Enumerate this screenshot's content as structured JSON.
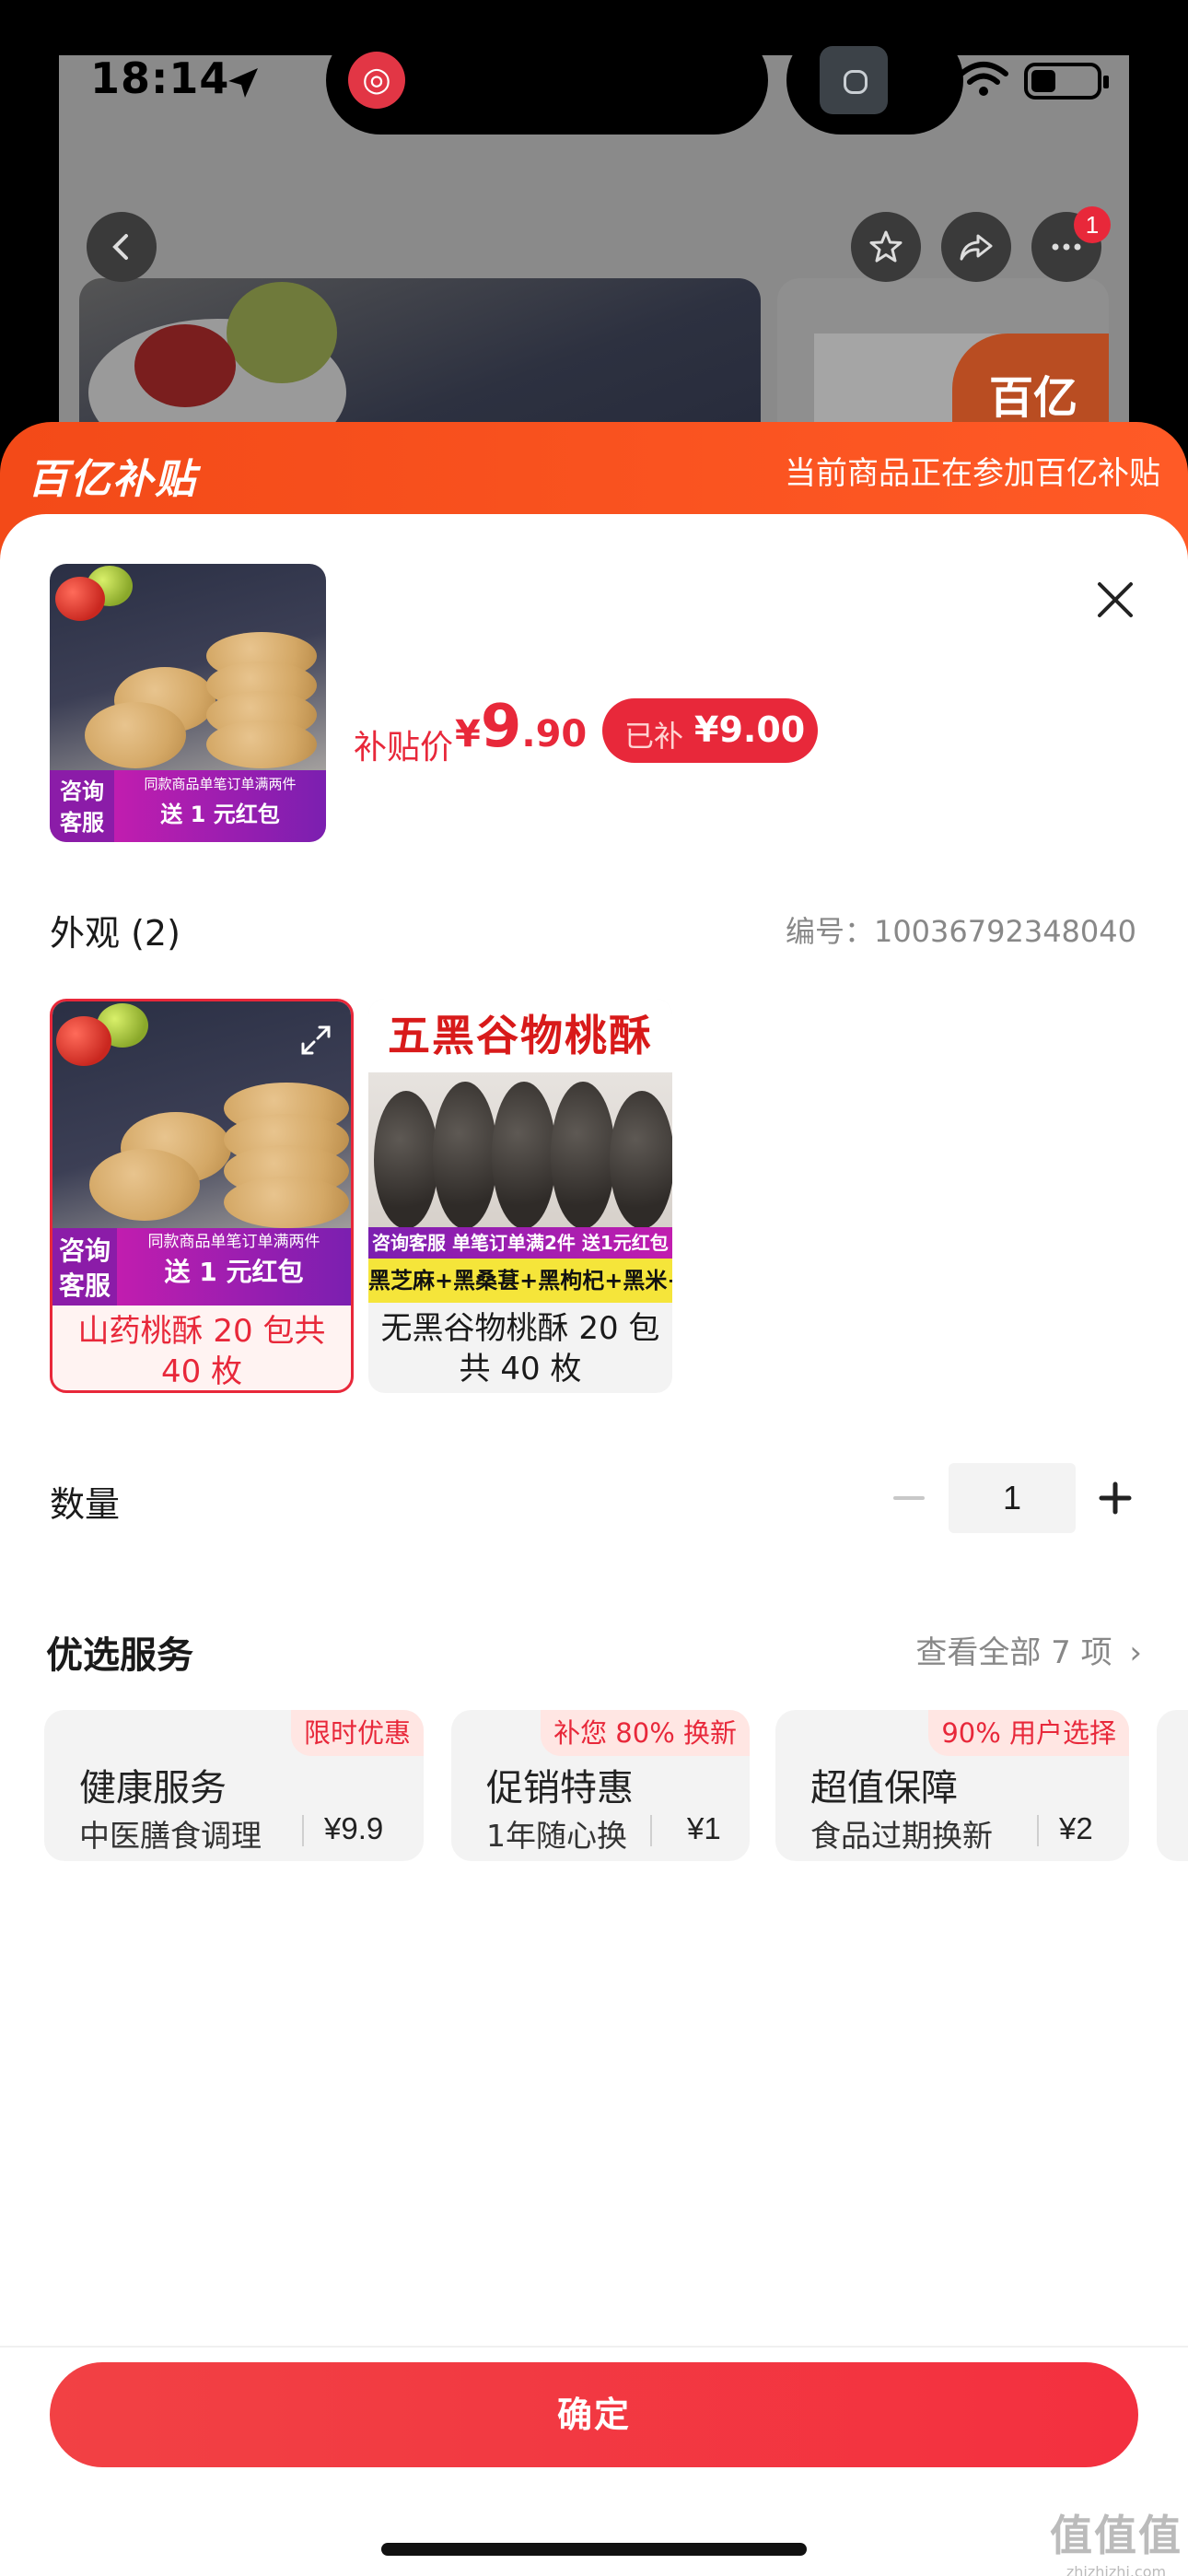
{
  "status_bar": {
    "time": "18:14"
  },
  "background_page": {
    "notification_count": "1",
    "logo_text": "百亿"
  },
  "sheet_header": {
    "brand": "百亿补贴",
    "note": "当前商品正在参加百亿补贴"
  },
  "product": {
    "price_label": "补贴价",
    "currency": "¥",
    "price_integer": "9",
    "price_decimal": ".90",
    "subsidy_label": "已补",
    "subsidy_amount": "¥9.00",
    "promo": {
      "consult": "咨询客服",
      "small": "同款商品单笔订单满两件",
      "big": "送 1 元红包"
    }
  },
  "appearance": {
    "title": "外观 (2)",
    "serial": "编号：10036792348040",
    "variants": [
      {
        "caption": "山药桃酥 20 包共 40 枚",
        "selected": true,
        "promo_consult": "咨询客服",
        "promo_big": "送 1 元红包"
      },
      {
        "caption": "无黑谷物桃酥 20 包共 40 枚",
        "selected": false,
        "headline": "五黑谷物桃酥",
        "promo_line": "咨询客服 单笔订单满2件 送1元红包",
        "ingredients": "黑芝麻+黑桑葚+黑枸杞+黑米+黑豆"
      }
    ]
  },
  "quantity": {
    "label": "数量",
    "value": "1"
  },
  "services": {
    "title": "优选服务",
    "view_all": "查看全部 7 项",
    "items": [
      {
        "tag": "限时优惠",
        "name": "健康服务",
        "desc": "中医膳食调理",
        "price": "¥9.9"
      },
      {
        "tag": "补您 80% 换新",
        "name": "促销特惠",
        "desc": "1年随心换",
        "price": "¥1"
      },
      {
        "tag": "90% 用户选择",
        "name": "超值保障",
        "desc": "食品过期换新",
        "price": "¥2"
      }
    ]
  },
  "confirm_label": "确定",
  "watermark": {
    "title": "值值值",
    "url": "zhizhizhi.com"
  },
  "colors": {
    "accent": "#e8283a",
    "brand_orange": "#f34a18"
  }
}
